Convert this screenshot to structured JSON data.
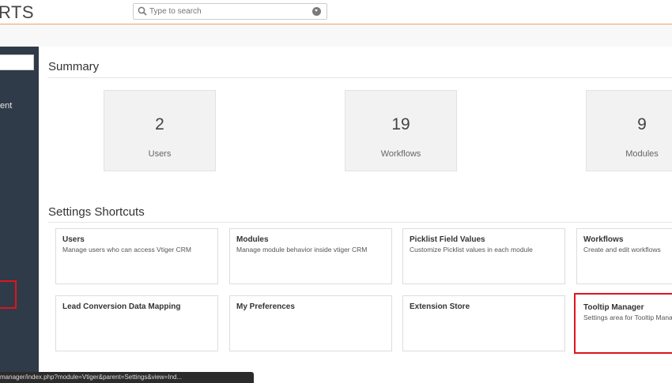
{
  "header": {
    "logo_text": "RTS",
    "search_placeholder": "Type to search"
  },
  "sidebar": {
    "partial_label": "ent"
  },
  "summary": {
    "title": "Summary",
    "cards": [
      {
        "value": "2",
        "label": "Users"
      },
      {
        "value": "19",
        "label": "Workflows"
      },
      {
        "value": "9",
        "label": "Modules"
      }
    ]
  },
  "shortcuts": {
    "title": "Settings Shortcuts",
    "items": [
      {
        "title": "Users",
        "desc": "Manage users who can access Vtiger CRM"
      },
      {
        "title": "Modules",
        "desc": "Manage module behavior inside vtiger CRM"
      },
      {
        "title": "Picklist Field Values",
        "desc": "Customize Picklist values in each module"
      },
      {
        "title": "Workflows",
        "desc": "Create and edit workflows"
      },
      {
        "title": "Lead Conversion Data Mapping",
        "desc": ""
      },
      {
        "title": "My Preferences",
        "desc": ""
      },
      {
        "title": "Extension Store",
        "desc": ""
      },
      {
        "title": "Tooltip Manager",
        "desc": "Settings area for Tooltip Manager"
      }
    ]
  },
  "statusbar": {
    "url": "manager/index.php?module=Vtiger&parent=Settings&view=Ind..."
  },
  "colors": {
    "sidebar_bg": "#2f3b48",
    "highlight": "#e0141e",
    "header_border": "#f0a35e"
  }
}
